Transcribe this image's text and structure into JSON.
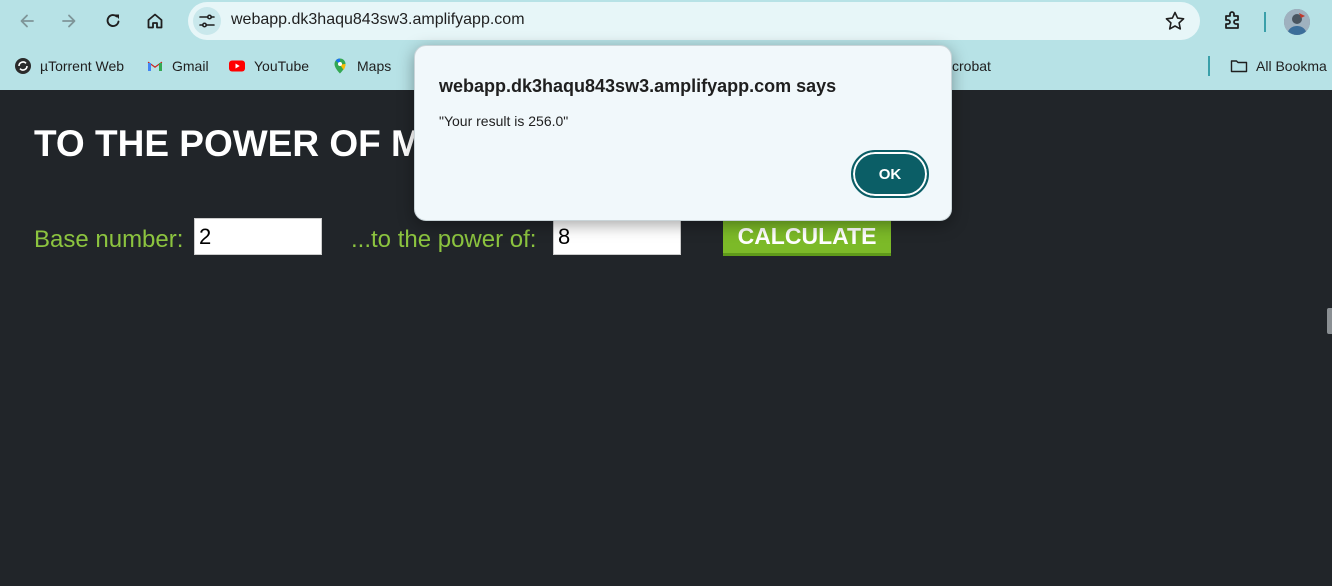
{
  "browser": {
    "url": "webapp.dk3haqu843sw3.amplifyapp.com",
    "bookmarks": [
      {
        "label": "µTorrent Web",
        "icon": "utorrent-icon"
      },
      {
        "label": "Gmail",
        "icon": "gmail-icon"
      },
      {
        "label": "YouTube",
        "icon": "youtube-icon"
      },
      {
        "label": "Maps",
        "icon": "maps-icon"
      },
      {
        "label": "crobat",
        "icon": "acrobat-icon"
      }
    ],
    "all_bookmarks_label": "All Bookma"
  },
  "page": {
    "heading": "TO THE POWER OF M",
    "base_label": "Base number:",
    "base_value": "2",
    "power_label": "...to the power of:",
    "power_value": "8",
    "calculate_label": "CALCULATE"
  },
  "dialog": {
    "title": "webapp.dk3haqu843sw3.amplifyapp.com says",
    "message": "\"Your result is 256.0\"",
    "ok_label": "OK"
  },
  "colors": {
    "page_background": "#212529",
    "label_green": "#8cc43f",
    "button_green": "#7cba28",
    "chrome_teal": "#b7e2e6",
    "ok_button": "#0b5e66"
  }
}
